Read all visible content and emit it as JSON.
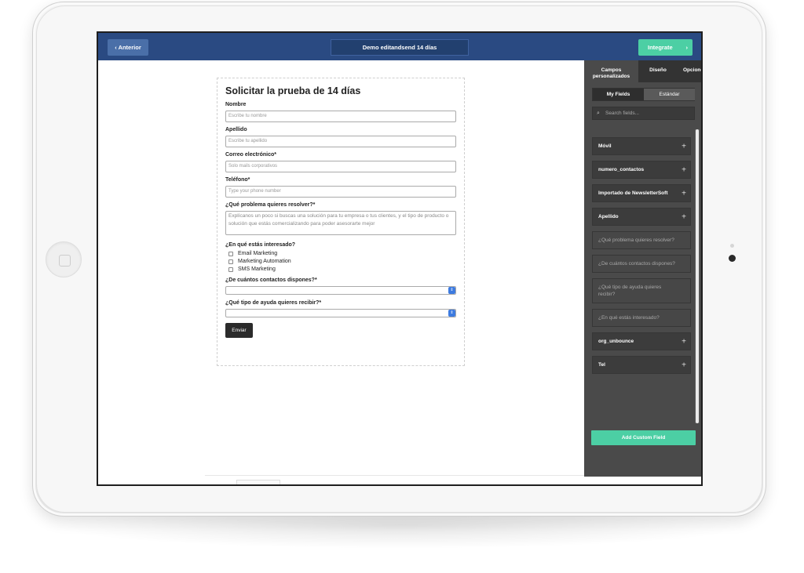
{
  "topbar": {
    "prev_label": "Anterior",
    "prev_chevron": "‹",
    "title": "Demo editandsend 14 días",
    "integrate_label": "Integrate",
    "integrate_chevron": "›"
  },
  "form": {
    "title": "Solicitar la prueba de 14 días",
    "fields": {
      "nombre": {
        "label": "Nombre",
        "placeholder": "Escribe tu nombre"
      },
      "apellido": {
        "label": "Apellido",
        "placeholder": "Escribe tu apellido"
      },
      "correo": {
        "label": "Correo electrónico*",
        "placeholder": "Solo mails corporativos"
      },
      "telefono": {
        "label": "Teléfono*",
        "placeholder": "Type your phone number"
      },
      "problema": {
        "label": "¿Qué problema quieres resolver?*",
        "placeholder": "Explícanos un poco si buscas una solución para tu empresa o tus clientes, y el tipo de producto o solución que estás comercializando para poder asesorarte mejor"
      },
      "interes": {
        "label": "¿En qué estás interesado?",
        "options": [
          "Email Marketing",
          "Marketing Automation",
          "SMS Marketing"
        ]
      },
      "contactos": {
        "label": "¿De cuántos contactos dispones?*",
        "value": ""
      },
      "ayuda": {
        "label": "¿Qué tipo de ayuda quieres recibir?*",
        "value": ""
      }
    },
    "submit_label": "Enviar"
  },
  "panel": {
    "tabs": [
      "Campos personalizados",
      "Diseño",
      "Opciones"
    ],
    "segments": {
      "my_fields": "My Fields",
      "standard": "Estándar"
    },
    "search_placeholder": "Search fields...",
    "fields": [
      {
        "label": "Móvil",
        "addable": true
      },
      {
        "label": "numero_contactos",
        "addable": true
      },
      {
        "label": "Importado de NewsletterSoft",
        "addable": true
      },
      {
        "label": "Apellido",
        "addable": true
      },
      {
        "label": "¿Qué problema quieres resolver?",
        "addable": false
      },
      {
        "label": "¿De cuántos contactos dispones?",
        "addable": false
      },
      {
        "label": "¿Qué tipo de ayuda quieres recibir?",
        "addable": false
      },
      {
        "label": "¿En qué estás interesado?",
        "addable": false
      },
      {
        "label": "org_unbounce",
        "addable": true
      },
      {
        "label": "Tel",
        "addable": true
      }
    ],
    "add_button": "Add Custom Field"
  },
  "icons": {
    "plus": "+",
    "search": "⌕",
    "select_arrow": "⇕"
  },
  "colors": {
    "topbar": "#2a4a82",
    "accent": "#4ccfa4",
    "panel": "#4a4a4a"
  }
}
